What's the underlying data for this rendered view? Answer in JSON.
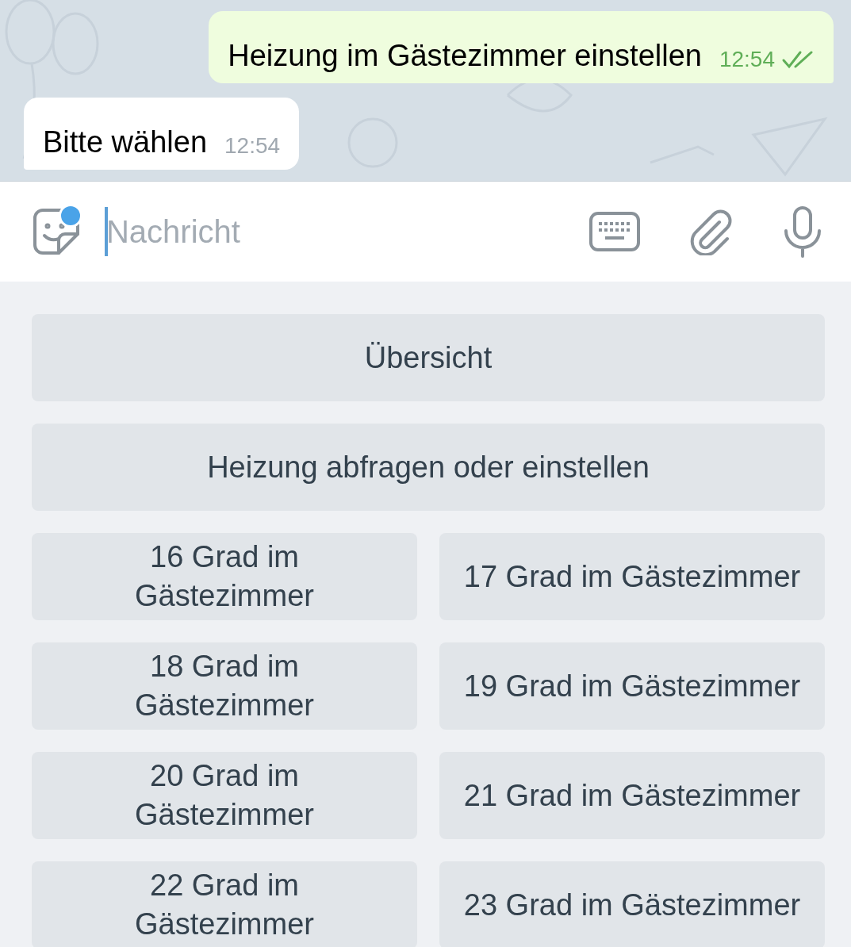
{
  "messages": [
    {
      "kind": "outgoing",
      "text": "Heizung im Gästezimmer einstellen",
      "time": "12:54",
      "read": true
    },
    {
      "kind": "incoming",
      "text": "Bitte wählen",
      "time": "12:54"
    }
  ],
  "composer": {
    "placeholder": "Nachricht",
    "sticker_badge": true,
    "focused": true
  },
  "keyboard": {
    "rows": [
      [
        "Übersicht"
      ],
      [
        "Heizung abfragen oder einstellen"
      ],
      [
        "16 Grad im Gästezimmer",
        "17 Grad im Gästezimmer"
      ],
      [
        "18 Grad im Gästezimmer",
        "19 Grad im Gästezimmer"
      ],
      [
        "20 Grad im Gästezimmer",
        "21 Grad im Gästezimmer"
      ],
      [
        "22 Grad im Gästezimmer",
        "23 Grad im Gästezimmer"
      ]
    ]
  }
}
